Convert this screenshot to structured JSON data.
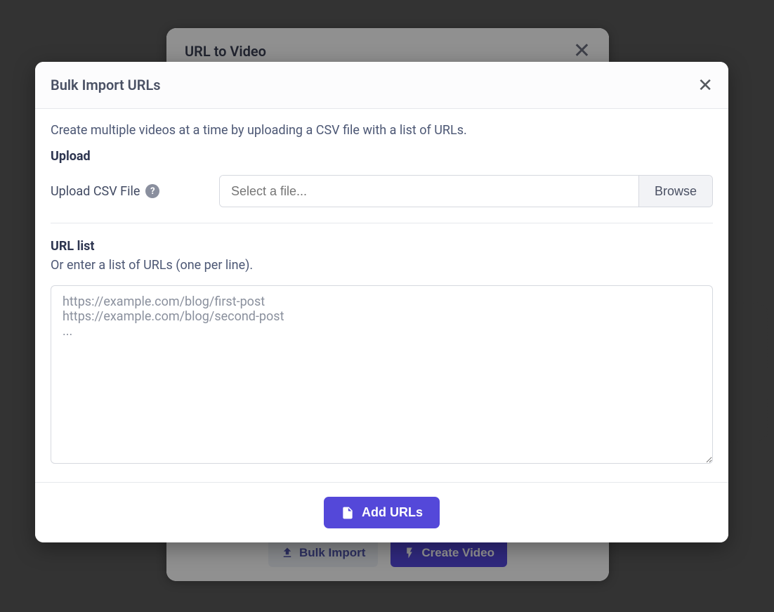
{
  "bgModal": {
    "title": "URL to Video",
    "bulkImportLabel": "Bulk Import",
    "createVideoLabel": "Create Video"
  },
  "modal": {
    "title": "Bulk Import URLs",
    "description": "Create multiple videos at a time by uploading a CSV file with a list of URLs.",
    "uploadHeading": "Upload",
    "uploadLabel": "Upload CSV File",
    "filePlaceholder": "Select a file...",
    "browseLabel": "Browse",
    "urlListHeading": "URL list",
    "urlListSubdesc": "Or enter a list of URLs (one per line).",
    "urlPlaceholder": "https://example.com/blog/first-post\nhttps://example.com/blog/second-post\n...",
    "addUrlsLabel": "Add URLs"
  },
  "icons": {
    "help": "?"
  }
}
